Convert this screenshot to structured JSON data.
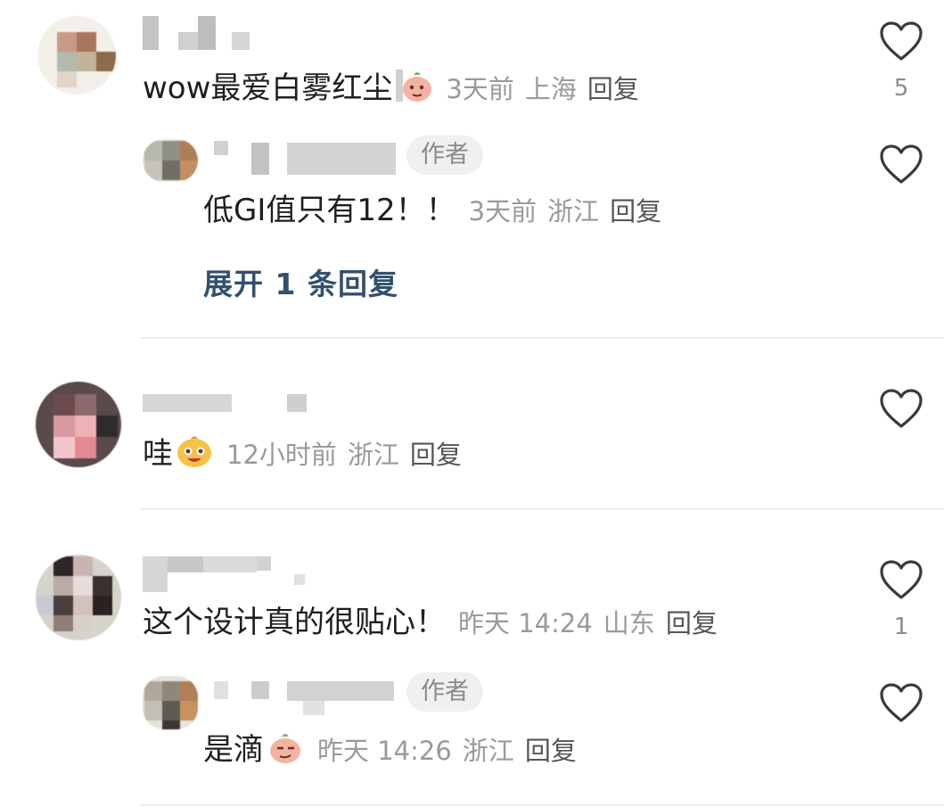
{
  "comments": [
    {
      "text": "wow最爱白雾红尘",
      "emoji": "peach-face-emoji",
      "time": "3天前",
      "location": "上海",
      "reply_label": "回复",
      "like_count": "5",
      "author_reply": {
        "badge": "作者",
        "text": "低GI值只有12！！",
        "time": "3天前",
        "location": "浙江",
        "reply_label": "回复"
      },
      "expand_label": "展开 1 条回复"
    },
    {
      "text": "哇",
      "emoji": "yellow-face-emoji",
      "time": "12小时前",
      "location": "浙江",
      "reply_label": "回复"
    },
    {
      "text": "这个设计真的很贴心！",
      "time": "昨天 14:24",
      "location": "山东",
      "reply_label": "回复",
      "like_count": "1",
      "author_reply": {
        "badge": "作者",
        "text": "是滴",
        "emoji": "peach-face-emoji",
        "time": "昨天 14:26",
        "location": "浙江",
        "reply_label": "回复"
      }
    }
  ],
  "icons": {
    "like": "heart-outline-icon"
  },
  "colors": {
    "link": "#33506e",
    "meta": "#9a9a9a",
    "badge_bg": "#eef0f2"
  }
}
